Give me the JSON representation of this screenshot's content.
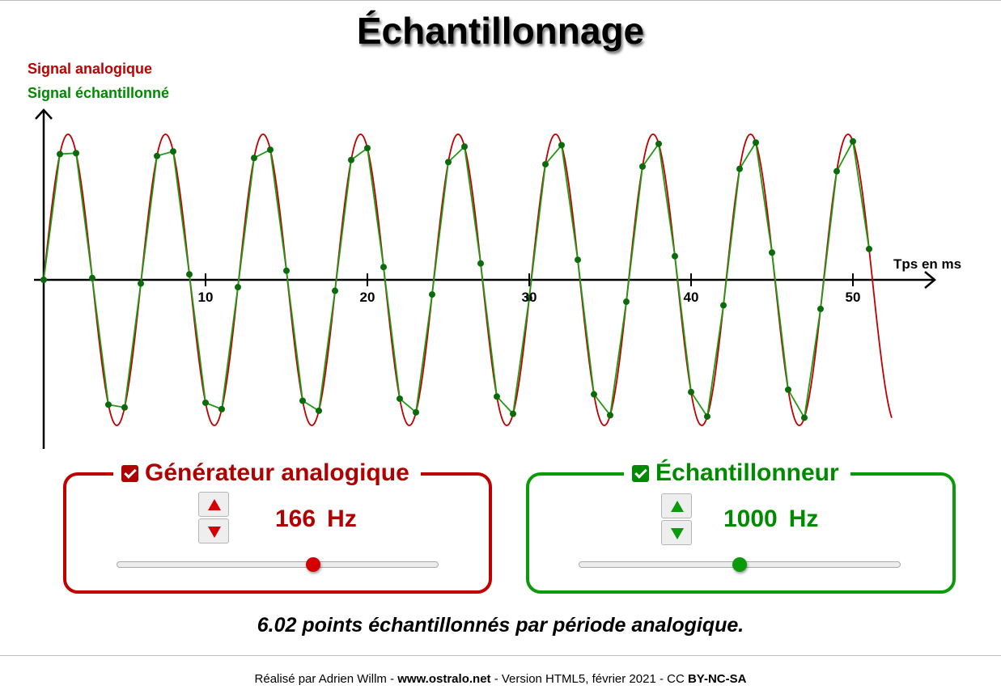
{
  "title": "Échantillonnage",
  "legend": {
    "analog": "Signal analogique",
    "sampled": "Signal échantillonné"
  },
  "chart_data": {
    "type": "line",
    "xlabel": "Tps en ms",
    "ylabel": "",
    "x_ticks": [
      10,
      20,
      30,
      40,
      50
    ],
    "x_tick_labels": [
      "10",
      "20",
      "30",
      "40",
      "50"
    ],
    "xlim": [
      0,
      52.4
    ],
    "ylim": [
      -1,
      1
    ],
    "grid": false,
    "series": [
      {
        "name": "Signal analogique",
        "kind": "continuous",
        "frequency_hz": 166,
        "amplitude": 1,
        "color": "#c00000"
      },
      {
        "name": "Signal échantillonné",
        "kind": "sampled",
        "sample_rate_hz": 1000,
        "color": "#0a8a0a"
      }
    ]
  },
  "colors": {
    "analog": "#c00000",
    "sampled": "#0a9a0a",
    "axis": "#000000"
  },
  "generator": {
    "title": "Générateur analogique",
    "checked": true,
    "value": "166",
    "unit": "Hz",
    "slider_fraction": 0.61,
    "up_icon": "triangle-up-icon",
    "down_icon": "triangle-down-icon"
  },
  "sampler": {
    "title": "Échantillonneur",
    "checked": true,
    "value": "1000",
    "unit": "Hz",
    "slider_fraction": 0.5,
    "up_icon": "triangle-up-icon",
    "down_icon": "triangle-down-icon"
  },
  "summary": "6.02 points échantillonnés par période analogique.",
  "footer": {
    "prefix": "Réalisé par Adrien Willm - ",
    "site": "www.ostralo.net",
    "middle": " - Version HTML5, février 2021 - CC ",
    "license": "BY-NC-SA"
  }
}
